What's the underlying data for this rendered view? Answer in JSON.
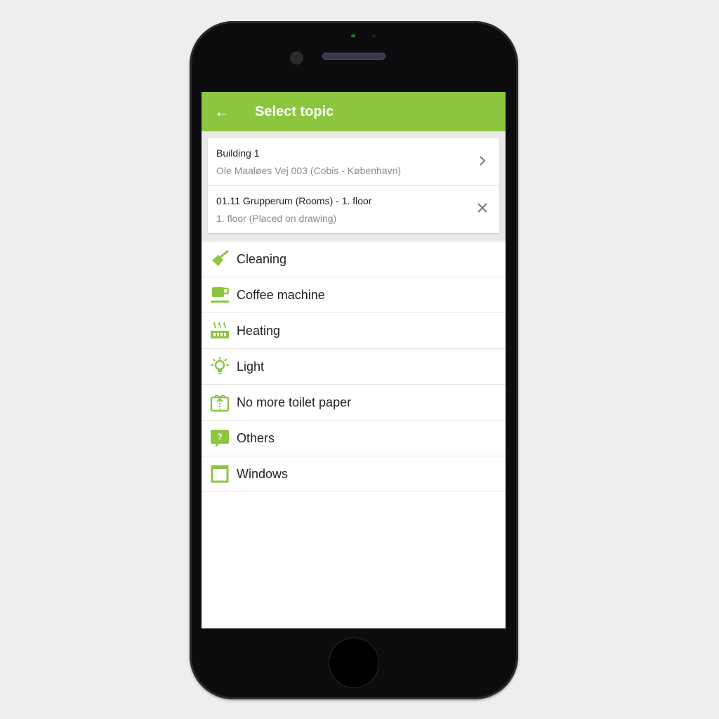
{
  "header": {
    "title": "Select topic",
    "back_icon": "arrow-left-icon"
  },
  "context": {
    "building": {
      "title": "Building 1",
      "subtitle": "Ole Maaløes Vej 003 (Cobis - København)",
      "action_icon": "chevron-right-icon"
    },
    "location": {
      "title": "01.11 Grupperum (Rooms) - 1. floor",
      "subtitle": "1. floor (Placed on drawing)",
      "action_icon": "close-icon"
    }
  },
  "topics": [
    {
      "label": "Cleaning",
      "icon": "broom-icon"
    },
    {
      "label": "Coffee machine",
      "icon": "coffee-cup-icon"
    },
    {
      "label": "Heating",
      "icon": "radiator-icon"
    },
    {
      "label": "Light",
      "icon": "lightbulb-icon"
    },
    {
      "label": "No more toilet paper",
      "icon": "gift-box-icon"
    },
    {
      "label": "Others",
      "icon": "question-bubble-icon"
    },
    {
      "label": "Windows",
      "icon": "window-icon"
    }
  ],
  "colors": {
    "accent": "#8cc63f"
  }
}
